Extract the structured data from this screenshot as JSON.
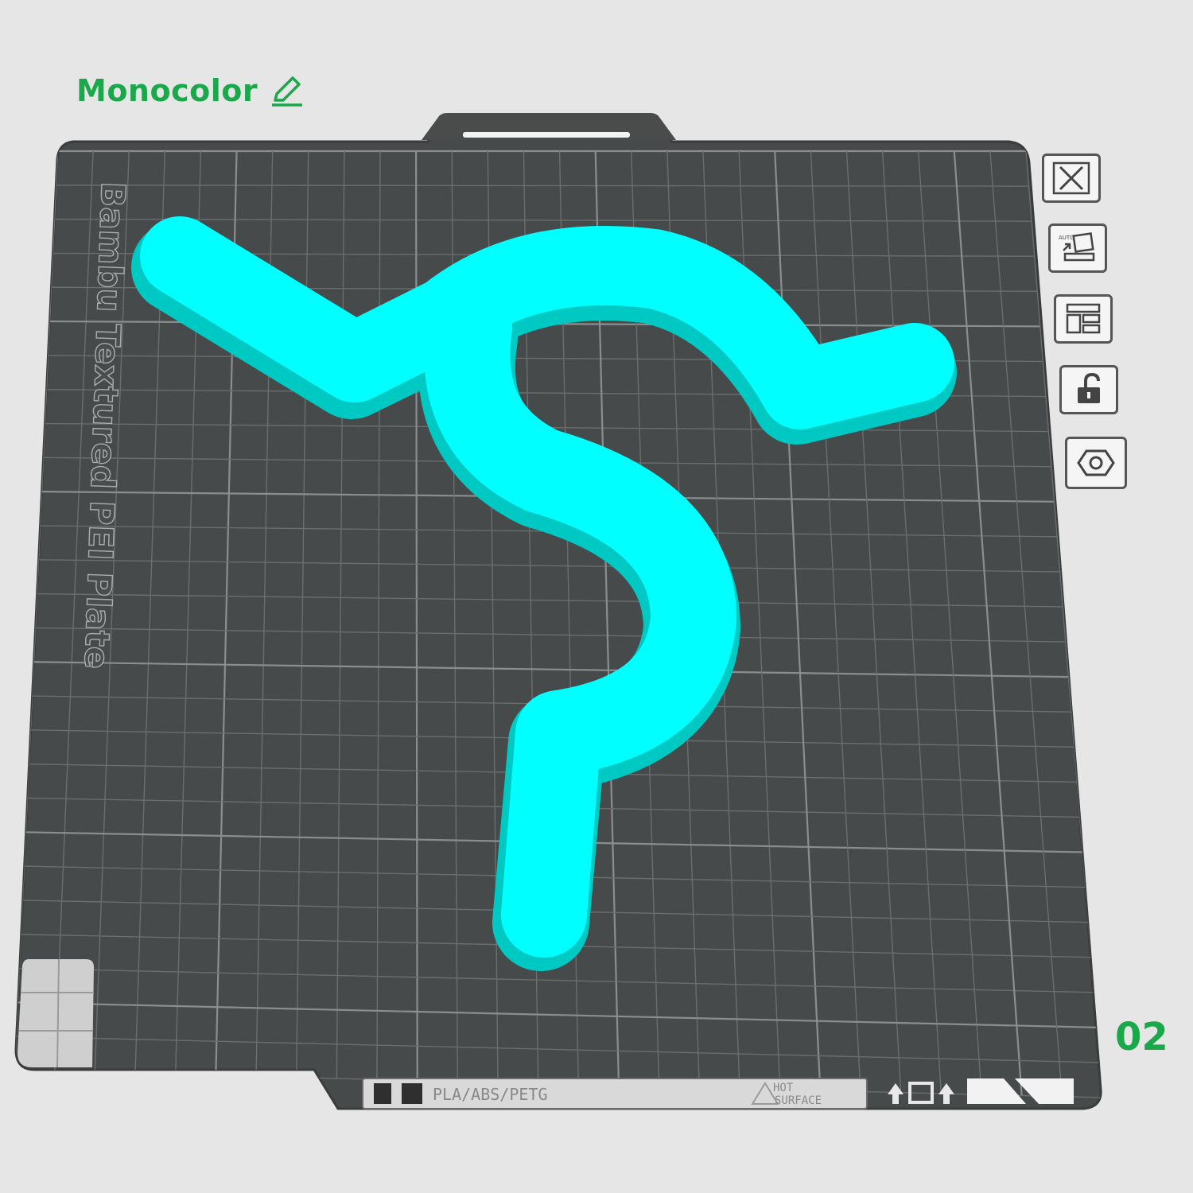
{
  "header": {
    "mode_label": "Monocolor"
  },
  "plate": {
    "name": "Bambu Textured PEI Plate",
    "material_label": "PLA/ABS/PETG",
    "warning_label_line1": "HOT",
    "warning_label_line2": "SURFACE",
    "number": "02"
  },
  "toolbar": {
    "items": [
      {
        "icon": "close-icon"
      },
      {
        "icon": "auto-orient-icon",
        "badge": "AUTO"
      },
      {
        "icon": "arrange-icon"
      },
      {
        "icon": "unlock-icon"
      },
      {
        "icon": "plate-settings-icon"
      }
    ]
  },
  "model": {
    "color": "#00ffff",
    "shadow_color": "#00d4cc"
  },
  "colors": {
    "accent": "#1aa84a",
    "plate": "#474a4a",
    "grid": "#6c7070",
    "background": "#e6e6e6"
  }
}
